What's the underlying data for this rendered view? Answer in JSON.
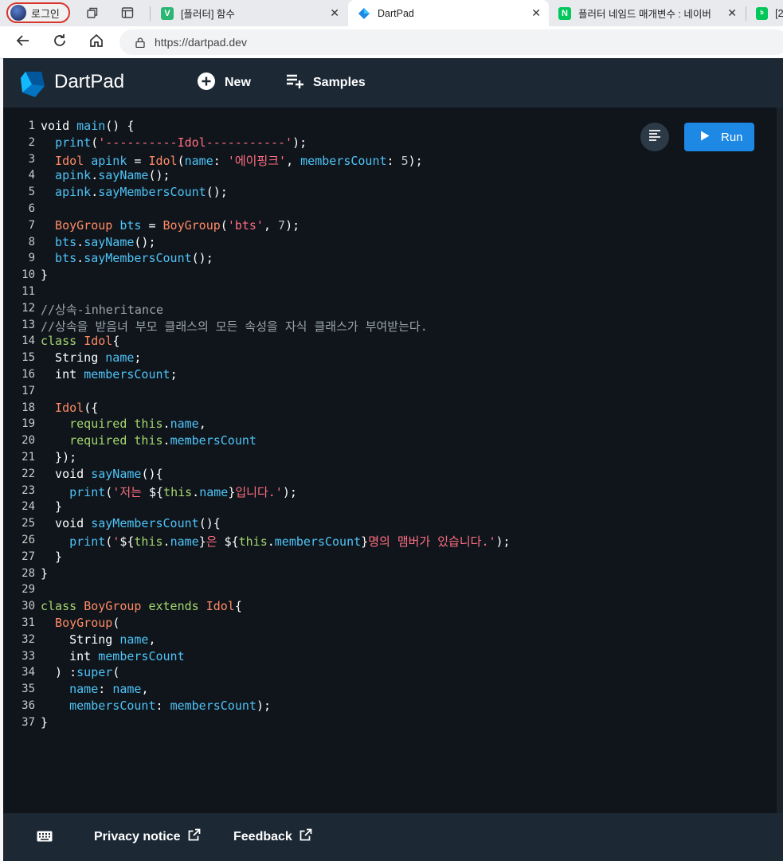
{
  "browser": {
    "profile_label": "로그인",
    "tabs": [
      {
        "title": "[플러터] 함수",
        "favicon_letter": "V",
        "favicon_color": "#2bb673",
        "active": false
      },
      {
        "title": "DartPad",
        "favicon_letter": "",
        "favicon_color": "#1e88e5",
        "active": true
      },
      {
        "title": "플러터 네임드 매개변수 : 네이버",
        "favicon_letter": "N",
        "favicon_color": "#03c75a",
        "active": false
      },
      {
        "title": "[2",
        "favicon_letter": "b",
        "favicon_color": "#03c75a",
        "active": false
      }
    ],
    "url": "https://dartpad.dev"
  },
  "app": {
    "brand": "DartPad",
    "new_label": "New",
    "samples_label": "Samples",
    "run_label": "Run",
    "privacy_label": "Privacy notice",
    "feedback_label": "Feedback",
    "colors": {
      "header": "#1c2834",
      "editor": "#0f151b",
      "run": "#1e88e5"
    }
  },
  "code": {
    "line_numbers": [
      "1",
      "2",
      "3",
      "4",
      "5",
      "6",
      "7",
      "8",
      "9",
      "10",
      "11",
      "12",
      "13",
      "14",
      "15",
      "16",
      "17",
      "18",
      "19",
      "20",
      "21",
      "22",
      "23",
      "24",
      "25",
      "26",
      "27",
      "28",
      "29",
      "30",
      "31",
      "32",
      "33",
      "34",
      "35",
      "36",
      "37"
    ],
    "lines": [
      [
        [
          "kw",
          "void "
        ],
        [
          "fn",
          "main"
        ],
        [
          "kw",
          "() {"
        ]
      ],
      [
        [
          "kw",
          "  "
        ],
        [
          "fn",
          "print"
        ],
        [
          "kw",
          "("
        ],
        [
          "st",
          "'----------Idol-----------'"
        ],
        [
          "kw",
          ");"
        ]
      ],
      [
        [
          "ty",
          "  Idol "
        ],
        [
          "id",
          "apink"
        ],
        [
          "kw",
          " = "
        ],
        [
          "ty",
          "Idol"
        ],
        [
          "kw",
          "("
        ],
        [
          "id",
          "name"
        ],
        [
          "kw",
          ": "
        ],
        [
          "st",
          "'에이핑크'"
        ],
        [
          "kw",
          ", "
        ],
        [
          "id",
          "membersCount"
        ],
        [
          "kw",
          ": "
        ],
        [
          "nu",
          "5"
        ],
        [
          "kw",
          ");"
        ]
      ],
      [
        [
          "id",
          "  apink"
        ],
        [
          "kw",
          "."
        ],
        [
          "fn",
          "sayName"
        ],
        [
          "kw",
          "();"
        ]
      ],
      [
        [
          "id",
          "  apink"
        ],
        [
          "kw",
          "."
        ],
        [
          "fn",
          "sayMembersCount"
        ],
        [
          "kw",
          "();"
        ]
      ],
      [],
      [
        [
          "ty",
          "  BoyGroup "
        ],
        [
          "id",
          "bts"
        ],
        [
          "kw",
          " = "
        ],
        [
          "ty",
          "BoyGroup"
        ],
        [
          "kw",
          "("
        ],
        [
          "st",
          "'bts'"
        ],
        [
          "kw",
          ", "
        ],
        [
          "nu",
          "7"
        ],
        [
          "kw",
          ");"
        ]
      ],
      [
        [
          "id",
          "  bts"
        ],
        [
          "kw",
          "."
        ],
        [
          "fn",
          "sayName"
        ],
        [
          "kw",
          "();"
        ]
      ],
      [
        [
          "id",
          "  bts"
        ],
        [
          "kw",
          "."
        ],
        [
          "fn",
          "sayMembersCount"
        ],
        [
          "kw",
          "();"
        ]
      ],
      [
        [
          "kw",
          "}"
        ]
      ],
      [],
      [
        [
          "cm",
          "//상속-inheritance"
        ]
      ],
      [
        [
          "cm",
          "//상속을 받음녀 부모 클래스의 모든 속성을 자식 클래스가 부여받는다."
        ]
      ],
      [
        [
          "kg",
          "class "
        ],
        [
          "ty",
          "Idol"
        ],
        [
          "kw",
          "{"
        ]
      ],
      [
        [
          "kw",
          "  String "
        ],
        [
          "id",
          "name"
        ],
        [
          "kw",
          ";"
        ]
      ],
      [
        [
          "kw",
          "  int "
        ],
        [
          "id",
          "membersCount"
        ],
        [
          "kw",
          ";"
        ]
      ],
      [],
      [
        [
          "ty",
          "  Idol"
        ],
        [
          "kw",
          "({"
        ]
      ],
      [
        [
          "kg",
          "    required this"
        ],
        [
          "kw",
          "."
        ],
        [
          "id",
          "name"
        ],
        [
          "kw",
          ","
        ]
      ],
      [
        [
          "kg",
          "    required this"
        ],
        [
          "kw",
          "."
        ],
        [
          "id",
          "membersCount"
        ]
      ],
      [
        [
          "kw",
          "  });"
        ]
      ],
      [
        [
          "kw",
          "  void "
        ],
        [
          "fn",
          "sayName"
        ],
        [
          "kw",
          "(){"
        ]
      ],
      [
        [
          "kw",
          "    "
        ],
        [
          "fn",
          "print"
        ],
        [
          "kw",
          "("
        ],
        [
          "st",
          "'저는 "
        ],
        [
          "kw",
          "${"
        ],
        [
          "kg",
          "this"
        ],
        [
          "kw",
          "."
        ],
        [
          "id",
          "name"
        ],
        [
          "kw",
          "}"
        ],
        [
          "st",
          "입니다.'"
        ],
        [
          "kw",
          ");"
        ]
      ],
      [
        [
          "kw",
          "  }"
        ]
      ],
      [
        [
          "kw",
          "  void "
        ],
        [
          "fn",
          "sayMembersCount"
        ],
        [
          "kw",
          "(){"
        ]
      ],
      [
        [
          "kw",
          "    "
        ],
        [
          "fn",
          "print"
        ],
        [
          "kw",
          "("
        ],
        [
          "st",
          "'"
        ],
        [
          "kw",
          "${"
        ],
        [
          "kg",
          "this"
        ],
        [
          "kw",
          "."
        ],
        [
          "id",
          "name"
        ],
        [
          "kw",
          "}"
        ],
        [
          "st",
          "은 "
        ],
        [
          "kw",
          "${"
        ],
        [
          "kg",
          "this"
        ],
        [
          "kw",
          "."
        ],
        [
          "id",
          "membersCount"
        ],
        [
          "kw",
          "}"
        ],
        [
          "st",
          "명의 맴버가 있습니다.'"
        ],
        [
          "kw",
          ");"
        ]
      ],
      [
        [
          "kw",
          "  }"
        ]
      ],
      [
        [
          "kw",
          "}"
        ]
      ],
      [],
      [
        [
          "kg",
          "class "
        ],
        [
          "ty",
          "BoyGroup "
        ],
        [
          "kg",
          "extends "
        ],
        [
          "ty",
          "Idol"
        ],
        [
          "kw",
          "{"
        ]
      ],
      [
        [
          "ty",
          "  BoyGroup"
        ],
        [
          "kw",
          "("
        ]
      ],
      [
        [
          "kw",
          "    String "
        ],
        [
          "id",
          "name"
        ],
        [
          "kw",
          ","
        ]
      ],
      [
        [
          "kw",
          "    int "
        ],
        [
          "id",
          "membersCount"
        ]
      ],
      [
        [
          "kw",
          "  ) :"
        ],
        [
          "fn",
          "super"
        ],
        [
          "kw",
          "("
        ]
      ],
      [
        [
          "id",
          "    name"
        ],
        [
          "kw",
          ": "
        ],
        [
          "id",
          "name"
        ],
        [
          "kw",
          ","
        ]
      ],
      [
        [
          "id",
          "    membersCount"
        ],
        [
          "kw",
          ": "
        ],
        [
          "id",
          "membersCount"
        ],
        [
          "kw",
          ");"
        ]
      ],
      [
        [
          "kw",
          "}"
        ]
      ]
    ]
  }
}
